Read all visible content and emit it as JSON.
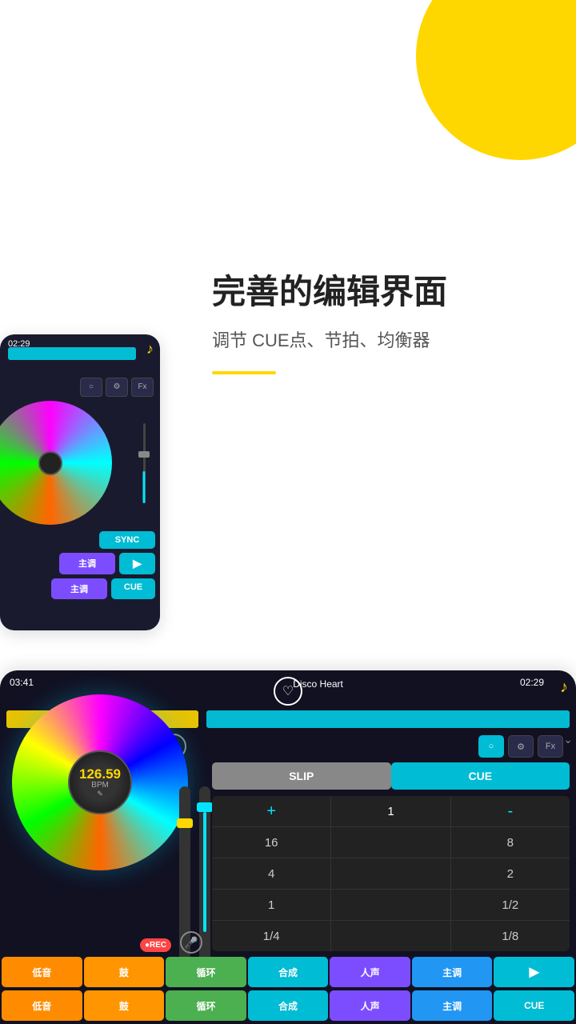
{
  "background": "#ffffff",
  "accent_color": "#FFD700",
  "blob": {
    "color": "#FFD700"
  },
  "text_section": {
    "main_title": "完善的编辑界面",
    "sub_title": "调节 CUE点、节拍、均衡器"
  },
  "device1": {
    "time": "02:29",
    "controls": [
      "○",
      "⚙",
      "Fx"
    ],
    "sync_label": "SYNC",
    "btn_row1": [
      "主调",
      "▶"
    ],
    "btn_row2": [
      "主调",
      "CUE"
    ]
  },
  "device2": {
    "time_left": "03:41",
    "track_name": "Disco Heart",
    "time_right": "02:29",
    "tabs": [
      "SLIP",
      "CUE"
    ],
    "grid": {
      "row1": [
        "+",
        "1",
        "-"
      ],
      "row2": [
        "16",
        "",
        "8"
      ],
      "row3": [
        "4",
        "",
        "2"
      ],
      "row4": [
        "1",
        "",
        "1/2"
      ],
      "row5": [
        "1/4",
        "",
        "1/8"
      ]
    },
    "bpm_value": "126.59",
    "bpm_label": "BPM",
    "rec_label": "●REC",
    "bottom_row1": [
      "低音",
      "鼓",
      "循环",
      "合成",
      "人声",
      "主调",
      "▶"
    ],
    "bottom_row2": [
      "低音",
      "鼓",
      "循环",
      "合成",
      "人声",
      "主调",
      "CUE"
    ],
    "controls": [
      "◇",
      "⚙",
      "〇",
      "≡",
      "Fx"
    ]
  }
}
